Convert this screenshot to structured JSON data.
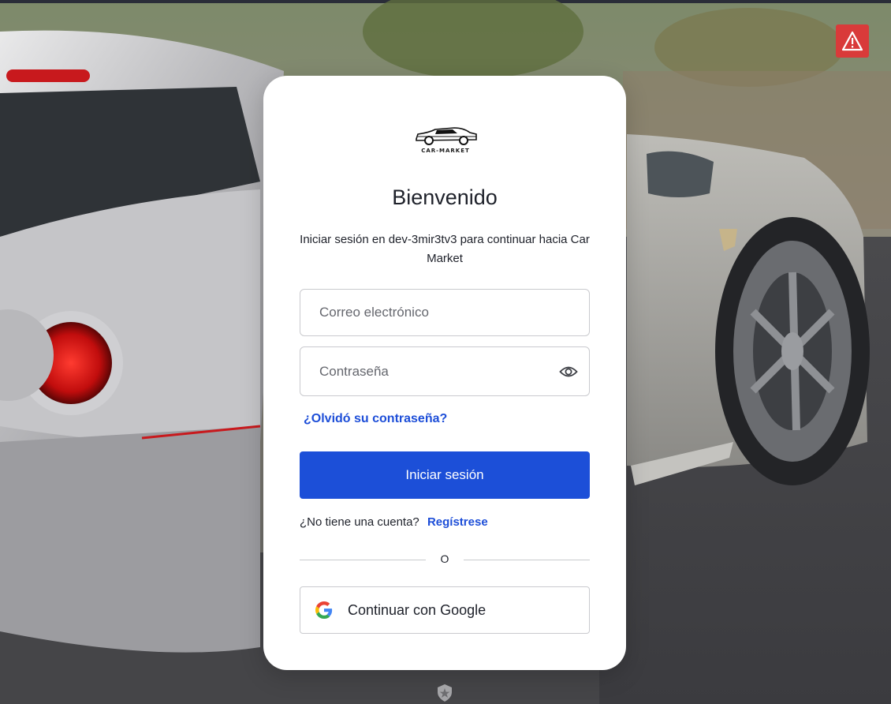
{
  "background": {
    "scene": "silver-sports-car-photo"
  },
  "warning": {
    "icon": "warning-triangle-icon",
    "color": "#d93a3a"
  },
  "logo": {
    "icon": "car-logo-icon",
    "text": "CAR-MARKET"
  },
  "login": {
    "title": "Bienvenido",
    "subtitle": "Iniciar sesión en dev-3mir3tv3 para continuar hacia Car Market",
    "email_placeholder": "Correo electrónico",
    "password_placeholder": "Contraseña",
    "forgot_label": "¿Olvidó su contraseña?",
    "submit_label": "Iniciar sesión",
    "signup_prompt": "¿No tiene una cuenta?",
    "signup_link": "Regístrese",
    "divider_label": "O",
    "google_label": "Continuar con Google"
  },
  "colors": {
    "accent": "#1c4fd8",
    "link": "#1d4ed8",
    "text": "#1e212a"
  },
  "footer": {
    "icon": "auth0-shield-icon"
  }
}
